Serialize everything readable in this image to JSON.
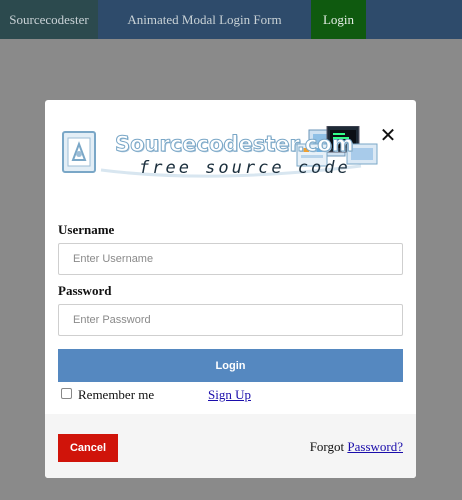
{
  "navbar": {
    "brand": "Sourcecodester",
    "title": "Animated Modal Login Form",
    "login": "Login"
  },
  "modal": {
    "close_glyph": "✕",
    "logo": {
      "name": "Sourcecodester.com",
      "tagline": "free source code"
    },
    "username": {
      "label": "Username",
      "placeholder": "Enter Username",
      "value": ""
    },
    "password": {
      "label": "Password",
      "placeholder": "Enter Password",
      "value": ""
    },
    "login_button": "Login",
    "remember_label": "Remember me",
    "remember_checked": false,
    "signup_link": "Sign Up",
    "cancel_button": "Cancel",
    "forgot_text": "Forgot",
    "forgot_link": "Password?"
  },
  "colors": {
    "overlay": "#8a8a8a",
    "navbar": "#2e4b6b",
    "nav_login": "#0f5a0f",
    "login_button": "#5588c0",
    "cancel_button": "#d0140a",
    "link": "#1a0dab"
  }
}
